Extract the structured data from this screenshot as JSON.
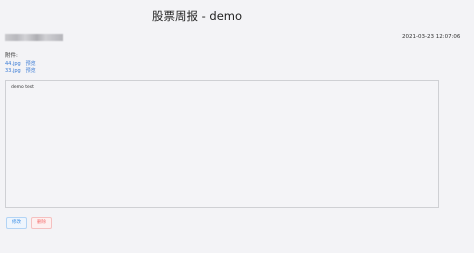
{
  "page": {
    "title": "股票周报 - demo",
    "timestamp": "2021-03-23 12:07:06"
  },
  "attachments": {
    "label": "附件:",
    "items": [
      {
        "filename": "44.jpg",
        "preview_label": "预览"
      },
      {
        "filename": "33.jpg",
        "preview_label": "预览"
      }
    ]
  },
  "editor": {
    "content": "demo test"
  },
  "actions": {
    "edit_label": "修改",
    "delete_label": "删除"
  },
  "colors": {
    "link": "#3a7bd5",
    "edit_button": "#3a8ee6",
    "delete_button": "#f56c6c"
  }
}
